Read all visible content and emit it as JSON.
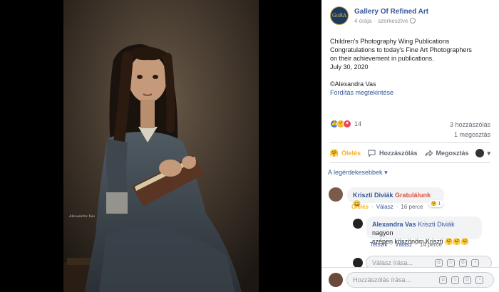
{
  "page": {
    "name": "Gallery Of Refined Art",
    "avatar_text": "GoRA",
    "time": "4 órája",
    "edited": "szerkesztve"
  },
  "post": {
    "line1": "Children's Photography Wing Publications",
    "line2": "Congratulations to today's Fine Art Photographers",
    "line3": "on their achievement in publications.",
    "line4": "July 30, 2020",
    "line5": "©Alexandra Vas",
    "translate": "Fordítás megtekintése"
  },
  "photo": {
    "watermark": "Alexandra Vas"
  },
  "stats": {
    "reaction_count": "14",
    "comments": "3 hozzászólás",
    "shares": "1 megosztás"
  },
  "actions": {
    "hug": "Ölelés",
    "comment": "Hozzászólás",
    "share": "Megosztás"
  },
  "sort_label": "A legérdekesebbek",
  "comments": [
    {
      "author": "Kriszti Diviák",
      "text": "Gratulálunk",
      "reaction_count": "1",
      "action_hug": "Ölelés",
      "action_reply": "Válasz",
      "time": "16 perce"
    },
    {
      "author": "Alexandra Vas",
      "mention": "Kriszti Diviák",
      "text_part1": "nagyon",
      "text_part2": "szépen köszönöm Kriszti",
      "action_like": "Tetszik",
      "action_reply": "Válasz",
      "time": "14 perce"
    }
  ],
  "inputs": {
    "reply_placeholder": "Válasz írása...",
    "comment_placeholder": "Hozzászólás írása..."
  },
  "colors": {
    "link": "#385898",
    "hug": "#f7b125",
    "background_bubble": "#f2f3f5"
  }
}
